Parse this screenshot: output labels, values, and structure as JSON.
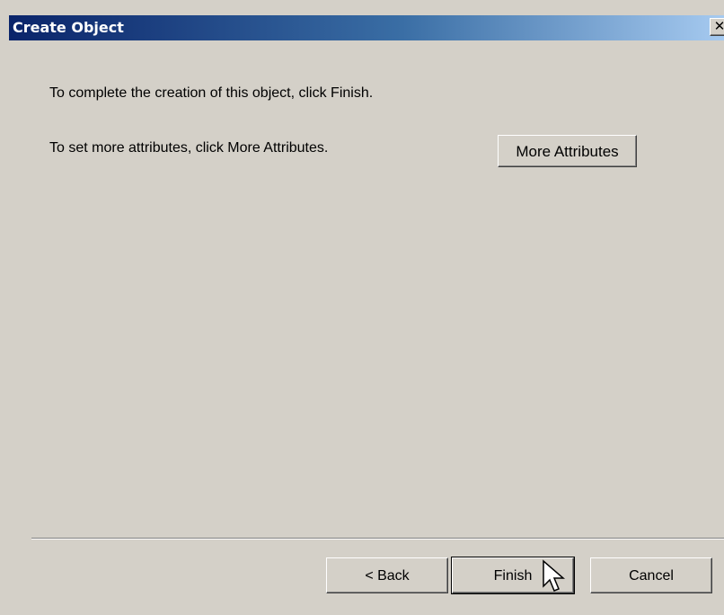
{
  "window": {
    "title": "Create Object",
    "close_glyph": "✕"
  },
  "content": {
    "finish_instruction": "To complete the creation of this object, click Finish.",
    "attributes_instruction": "To set more attributes, click More Attributes.",
    "more_attributes_label": "More Attributes"
  },
  "footer": {
    "back_label": "< Back",
    "finish_label": "Finish",
    "cancel_label": "Cancel"
  },
  "cursor": {
    "icon": "arrow-pointer-icon"
  },
  "colors": {
    "titlebar_start": "#0a246a",
    "titlebar_end": "#a6caf0",
    "dialog_background": "#d4d0c8"
  }
}
